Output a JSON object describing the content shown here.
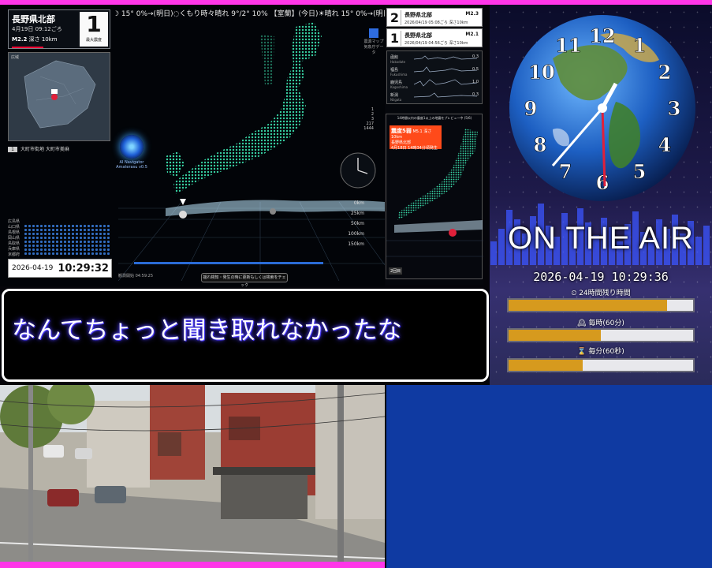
{
  "ticker": "☽ 15° 0%→(明日)◌くもり時々晴れ 9°/2° 10% 【室蘭】(今日)☀晴れ 15° 0%→(明日)☀晴れ昼前までくも",
  "quake": {
    "location": "長野県北部",
    "time": "4月19日 09:12ごろ",
    "magnitude": "M2.2",
    "depth": "深さ 10km",
    "intensity": "1",
    "intensity_caption": "最大震度"
  },
  "minimap_label": "広域",
  "region": {
    "index": "1",
    "name": "大町市街地 大町市美麻"
  },
  "ai": {
    "name": "AI Navigator",
    "version": "Amaterasu v0.5"
  },
  "intensity_list": [
    "広島県",
    "山口県",
    "島根県",
    "岡山県",
    "鳥取県",
    "兵庫県",
    "京都府",
    "福井県"
  ],
  "clock": {
    "date": "2026-04-19",
    "time": "10:29:32"
  },
  "check_button": "揺れ検知・発生の時に更新もしくは検索をチェック",
  "footnote": "観測開始 04:59:25",
  "depth_labels": [
    "0km",
    "25km",
    "50km",
    "100km",
    "150km"
  ],
  "side_info": "震源マップ 気象庁データ",
  "count_list": [
    "1",
    "2",
    "3",
    "217",
    "1444"
  ],
  "history": [
    {
      "num": "2",
      "loc": "長野県北部",
      "mag": "M2.3",
      "time": "2026/04/19 05:08ごろ 深さ10km"
    },
    {
      "num": "1",
      "loc": "長野県北部",
      "mag": "M2.1",
      "time": "2026/04/19 04:56ごろ 深さ10km"
    }
  ],
  "seismo": [
    {
      "name": "函館",
      "sub": "Hakodate",
      "val": "0.3"
    },
    {
      "name": "福島",
      "sub": "Fukushima",
      "val": "0.5"
    },
    {
      "name": "鹿児島",
      "sub": "Kagoshima",
      "val": "1.0"
    },
    {
      "name": "新潟",
      "sub": "Niigata",
      "val": "0.3"
    }
  ],
  "preview": {
    "header": "14時間以内の震度1以上の地震をプレビュー中 (5/6)",
    "warn_title": "震度5弱",
    "warn_mag": "M5.1 深さ10km",
    "warn_loc": "長野県北部",
    "warn_time": "4月18日 14時34分頃発生",
    "badge": "2回目"
  },
  "onair": "ON THE AIR",
  "stamp": "2026-04-19 10:29:36",
  "gauges": [
    {
      "label": "⏲ 24時間残り時間",
      "fill": 0.86
    },
    {
      "label": "🕰 毎時(60分)",
      "fill": 0.5
    },
    {
      "label": "⌛ 毎分(60秒)",
      "fill": 0.4
    }
  ],
  "subtitle": "なんてちょっと聞き取れなかったな"
}
